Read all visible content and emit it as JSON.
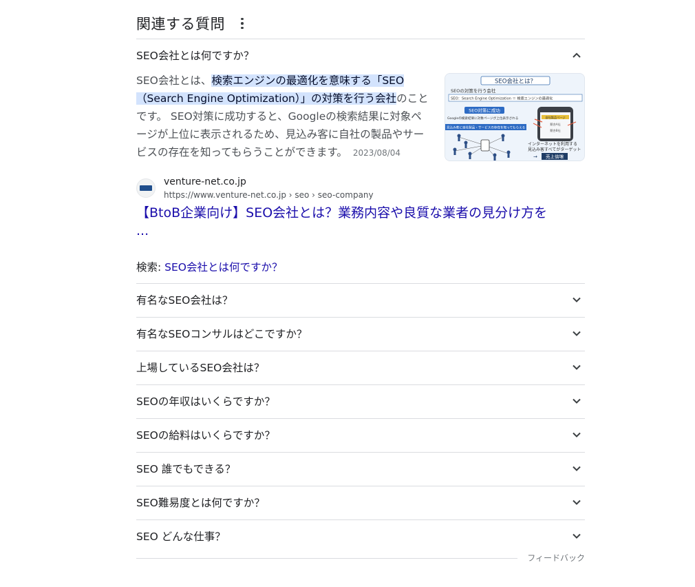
{
  "header": {
    "title": "関連する質問"
  },
  "expanded": {
    "question": "SEO会社とは何ですか？",
    "answer_pre": "SEO会社とは、",
    "answer_highlight": "検索エンジンの最適化を意味する「SEO（Search Engine Optimization）」の対策を行う会社",
    "answer_post": "のことです。 SEO対策に成功すると、Googleの検索結果に対象ページが上位に表示されるため、見込み客に自社の製品やサービスの存在を知ってもらうことができます。",
    "date": "2023/08/04",
    "thumbnail": {
      "title": "SEO会社とは？",
      "line1": "SEOの対策を行う会社",
      "line2": "SEO：Search Engine Optimization ＝ 検索エンジンの最適化",
      "badge": "SEO対策に成功",
      "line3": "Googleの検索結果に対象ページが上位表示される",
      "line4": "見込み客に自社製品・サービスの存在を知ってもらえる",
      "line5": "インターネットを利用する",
      "line6": "見込み客すべてがターゲット",
      "cta": "売上倍増",
      "phone_label": "自社製品ページ",
      "rank1": "競合A社",
      "rank2": "競合B社"
    },
    "source": {
      "site_name": "venture-net.co.jp",
      "url": "https://www.venture-net.co.jp › seo › seo-company"
    },
    "result_title": "【BtoB企業向け】SEO会社とは？業務内容や良質な業者の見分け方を ...",
    "search_prefix": "検索: ",
    "search_link": "SEO会社とは何ですか？"
  },
  "questions": [
    "有名なSEO会社は？",
    "有名なSEOコンサルはどこですか？",
    "上場しているSEO会社は？",
    "SEOの年収はいくらですか？",
    "SEOの給料はいくらですか？",
    "SEO 誰でもできる？",
    "SEO難易度とは何ですか？",
    "SEO どんな仕事？"
  ],
  "feedback": "フィードバック",
  "colors": {
    "link": "#1a0dab",
    "highlight": "#d3e3fd",
    "divider": "#dadce0"
  }
}
